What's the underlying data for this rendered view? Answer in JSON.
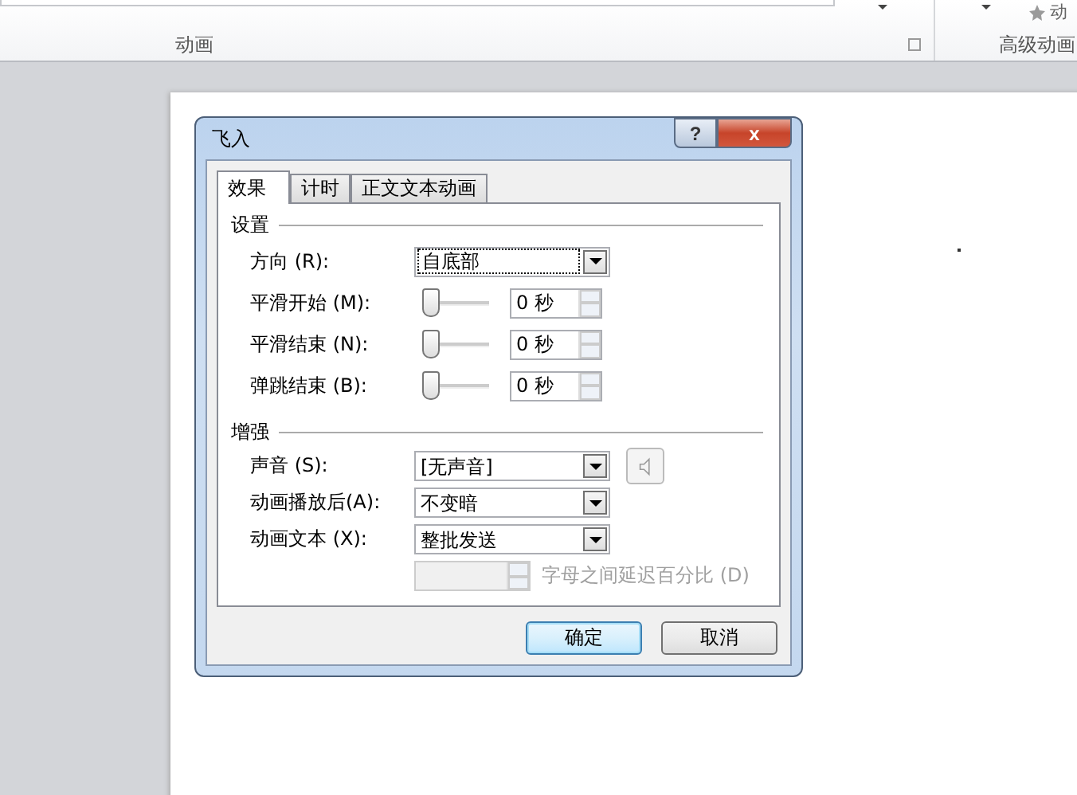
{
  "ribbon": {
    "groups": [
      {
        "label": "动画"
      },
      {
        "label": "高级动画"
      }
    ],
    "cut_button": "动"
  },
  "dialog": {
    "title": "飞入",
    "help": "?",
    "close": "x",
    "tabs": [
      {
        "label": "效果",
        "selected": true
      },
      {
        "label": "计时",
        "selected": false
      },
      {
        "label": "正文文本动画",
        "selected": false
      }
    ],
    "sections": [
      {
        "heading": "设置",
        "rows": [
          {
            "kind": "dropdown",
            "label": "方向 (R):",
            "value": "自底部",
            "focused": true
          },
          {
            "kind": "slider",
            "label": "平滑开始 (M):",
            "spin": "0 秒"
          },
          {
            "kind": "slider",
            "label": "平滑结束 (N):",
            "spin": "0 秒"
          },
          {
            "kind": "slider",
            "label": "弹跳结束 (B):",
            "spin": "0 秒"
          }
        ]
      },
      {
        "heading": "增强",
        "rows": [
          {
            "kind": "dropdown",
            "label": "声音 (S):",
            "value": "[无声音]",
            "focused": false,
            "speaker": true
          },
          {
            "kind": "dropdown",
            "label": "动画播放后(A):",
            "value": "不变暗",
            "focused": false
          },
          {
            "kind": "dropdown",
            "label": "动画文本 (X):",
            "value": "整批发送",
            "focused": false
          },
          {
            "kind": "delay",
            "label": "字母之间延迟百分比 (D)",
            "disabled": true
          }
        ]
      }
    ],
    "buttons": [
      {
        "label": "确定",
        "default": true
      },
      {
        "label": "取消",
        "default": false
      }
    ]
  }
}
